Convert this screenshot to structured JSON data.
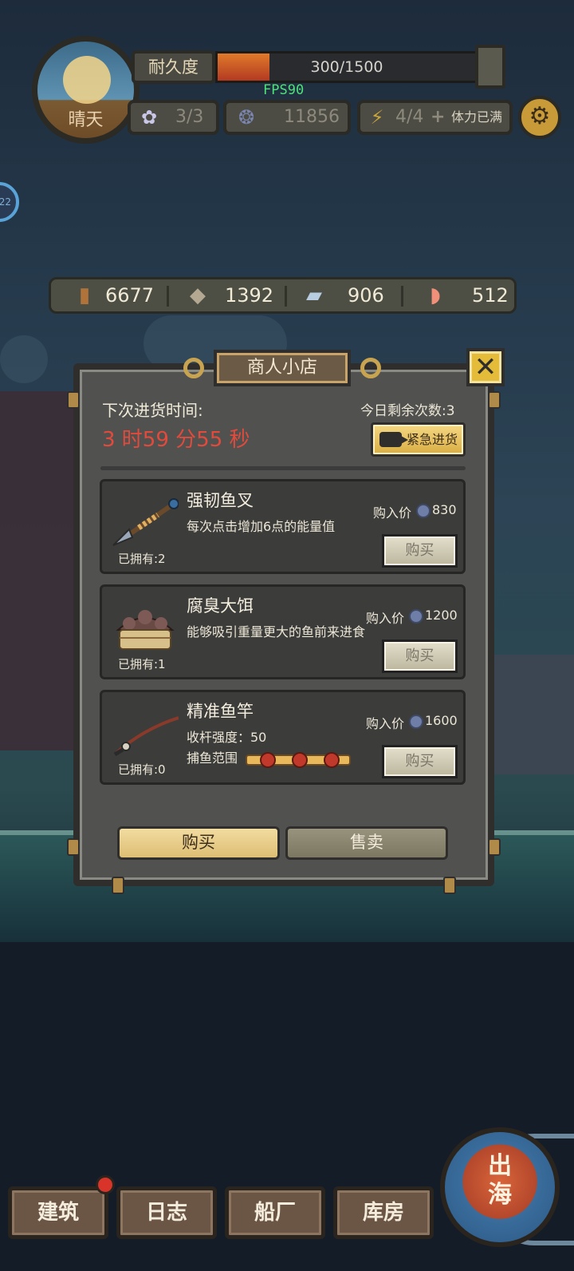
{
  "hud": {
    "weather": "晴天",
    "durability_label": "耐久度",
    "durability_text": "300/1500",
    "durability_fraction": 0.2,
    "fps": "FPS90",
    "bait": "3/3",
    "coins": "11856",
    "stamina": "4/4",
    "stamina_plus": "+",
    "stamina_status": "体力已满",
    "side_badge": "22"
  },
  "resources": [
    {
      "icon": "wood-icon",
      "value": "6677"
    },
    {
      "icon": "stone-icon",
      "value": "1392"
    },
    {
      "icon": "iron-ingot-icon",
      "value": "906"
    },
    {
      "icon": "fish-meat-icon",
      "value": "512"
    }
  ],
  "shop": {
    "title": "商人小店",
    "close": "✕",
    "next_restock_label": "下次进货时间:",
    "countdown": "3 时59 分55 秒",
    "remaining_today": "今日剩余次数:3",
    "urgent_restock": "紧急进货",
    "items": [
      {
        "name": "强韧鱼叉",
        "desc": "每次点击增加6点的能量值",
        "owned": "已拥有:2",
        "price_label": "购入价",
        "price": "830",
        "buy": "购买"
      },
      {
        "name": "腐臭大饵",
        "desc": "能够吸引重量更大的鱼前来进食",
        "owned": "已拥有:1",
        "price_label": "购入价",
        "price": "1200",
        "buy": "购买"
      },
      {
        "name": "精准鱼竿",
        "desc": "收杆强度：50",
        "range_label": "捕鱼范围",
        "owned": "已拥有:0",
        "price_label": "购入价",
        "price": "1600",
        "buy": "购买"
      }
    ],
    "tab_buy": "购买",
    "tab_sell": "售卖"
  },
  "nav": {
    "build": "建筑",
    "log": "日志",
    "shipyard": "船厂",
    "warehouse": "库房",
    "go_sea": "出\n海"
  },
  "colors": {
    "countdown": "#e24a3c",
    "gold_button": "#e4bc3a",
    "panel": "#515250"
  }
}
